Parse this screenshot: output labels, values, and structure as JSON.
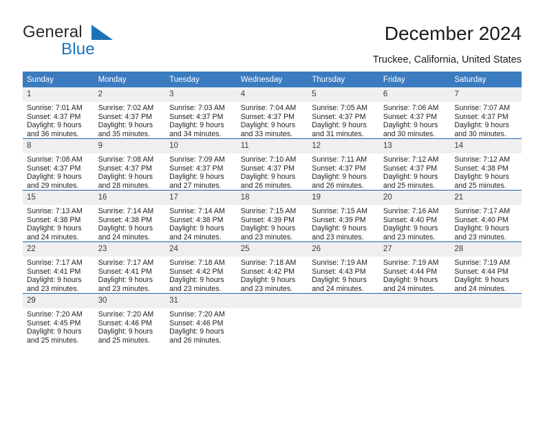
{
  "brand": {
    "word_one": "General",
    "word_two": "Blue",
    "triangle_icon": "blue-triangle-icon",
    "accent_color": "#1a72b8"
  },
  "header": {
    "title": "December 2024",
    "subtitle": "Truckee, California, United States"
  },
  "calendar": {
    "header_color": "#3b7cc0",
    "daynum_band_color": "#efefef",
    "rule_color": "#1f62a8",
    "weekday_headers": [
      "Sunday",
      "Monday",
      "Tuesday",
      "Wednesday",
      "Thursday",
      "Friday",
      "Saturday"
    ],
    "weeks": [
      [
        {
          "day": "1",
          "info": "Sunrise: 7:01 AM\nSunset: 4:37 PM\nDaylight: 9 hours\nand 36 minutes."
        },
        {
          "day": "2",
          "info": "Sunrise: 7:02 AM\nSunset: 4:37 PM\nDaylight: 9 hours\nand 35 minutes."
        },
        {
          "day": "3",
          "info": "Sunrise: 7:03 AM\nSunset: 4:37 PM\nDaylight: 9 hours\nand 34 minutes."
        },
        {
          "day": "4",
          "info": "Sunrise: 7:04 AM\nSunset: 4:37 PM\nDaylight: 9 hours\nand 33 minutes."
        },
        {
          "day": "5",
          "info": "Sunrise: 7:05 AM\nSunset: 4:37 PM\nDaylight: 9 hours\nand 31 minutes."
        },
        {
          "day": "6",
          "info": "Sunrise: 7:06 AM\nSunset: 4:37 PM\nDaylight: 9 hours\nand 30 minutes."
        },
        {
          "day": "7",
          "info": "Sunrise: 7:07 AM\nSunset: 4:37 PM\nDaylight: 9 hours\nand 30 minutes."
        }
      ],
      [
        {
          "day": "8",
          "info": "Sunrise: 7:08 AM\nSunset: 4:37 PM\nDaylight: 9 hours\nand 29 minutes."
        },
        {
          "day": "9",
          "info": "Sunrise: 7:08 AM\nSunset: 4:37 PM\nDaylight: 9 hours\nand 28 minutes."
        },
        {
          "day": "10",
          "info": "Sunrise: 7:09 AM\nSunset: 4:37 PM\nDaylight: 9 hours\nand 27 minutes."
        },
        {
          "day": "11",
          "info": "Sunrise: 7:10 AM\nSunset: 4:37 PM\nDaylight: 9 hours\nand 26 minutes."
        },
        {
          "day": "12",
          "info": "Sunrise: 7:11 AM\nSunset: 4:37 PM\nDaylight: 9 hours\nand 26 minutes."
        },
        {
          "day": "13",
          "info": "Sunrise: 7:12 AM\nSunset: 4:37 PM\nDaylight: 9 hours\nand 25 minutes."
        },
        {
          "day": "14",
          "info": "Sunrise: 7:12 AM\nSunset: 4:38 PM\nDaylight: 9 hours\nand 25 minutes."
        }
      ],
      [
        {
          "day": "15",
          "info": "Sunrise: 7:13 AM\nSunset: 4:38 PM\nDaylight: 9 hours\nand 24 minutes."
        },
        {
          "day": "16",
          "info": "Sunrise: 7:14 AM\nSunset: 4:38 PM\nDaylight: 9 hours\nand 24 minutes."
        },
        {
          "day": "17",
          "info": "Sunrise: 7:14 AM\nSunset: 4:38 PM\nDaylight: 9 hours\nand 24 minutes."
        },
        {
          "day": "18",
          "info": "Sunrise: 7:15 AM\nSunset: 4:39 PM\nDaylight: 9 hours\nand 23 minutes."
        },
        {
          "day": "19",
          "info": "Sunrise: 7:15 AM\nSunset: 4:39 PM\nDaylight: 9 hours\nand 23 minutes."
        },
        {
          "day": "20",
          "info": "Sunrise: 7:16 AM\nSunset: 4:40 PM\nDaylight: 9 hours\nand 23 minutes."
        },
        {
          "day": "21",
          "info": "Sunrise: 7:17 AM\nSunset: 4:40 PM\nDaylight: 9 hours\nand 23 minutes."
        }
      ],
      [
        {
          "day": "22",
          "info": "Sunrise: 7:17 AM\nSunset: 4:41 PM\nDaylight: 9 hours\nand 23 minutes."
        },
        {
          "day": "23",
          "info": "Sunrise: 7:17 AM\nSunset: 4:41 PM\nDaylight: 9 hours\nand 23 minutes."
        },
        {
          "day": "24",
          "info": "Sunrise: 7:18 AM\nSunset: 4:42 PM\nDaylight: 9 hours\nand 23 minutes."
        },
        {
          "day": "25",
          "info": "Sunrise: 7:18 AM\nSunset: 4:42 PM\nDaylight: 9 hours\nand 23 minutes."
        },
        {
          "day": "26",
          "info": "Sunrise: 7:19 AM\nSunset: 4:43 PM\nDaylight: 9 hours\nand 24 minutes."
        },
        {
          "day": "27",
          "info": "Sunrise: 7:19 AM\nSunset: 4:44 PM\nDaylight: 9 hours\nand 24 minutes."
        },
        {
          "day": "28",
          "info": "Sunrise: 7:19 AM\nSunset: 4:44 PM\nDaylight: 9 hours\nand 24 minutes."
        }
      ],
      [
        {
          "day": "29",
          "info": "Sunrise: 7:20 AM\nSunset: 4:45 PM\nDaylight: 9 hours\nand 25 minutes."
        },
        {
          "day": "30",
          "info": "Sunrise: 7:20 AM\nSunset: 4:46 PM\nDaylight: 9 hours\nand 25 minutes."
        },
        {
          "day": "31",
          "info": "Sunrise: 7:20 AM\nSunset: 4:46 PM\nDaylight: 9 hours\nand 26 minutes."
        },
        {
          "day": "",
          "info": ""
        },
        {
          "day": "",
          "info": ""
        },
        {
          "day": "",
          "info": ""
        },
        {
          "day": "",
          "info": ""
        }
      ]
    ]
  }
}
